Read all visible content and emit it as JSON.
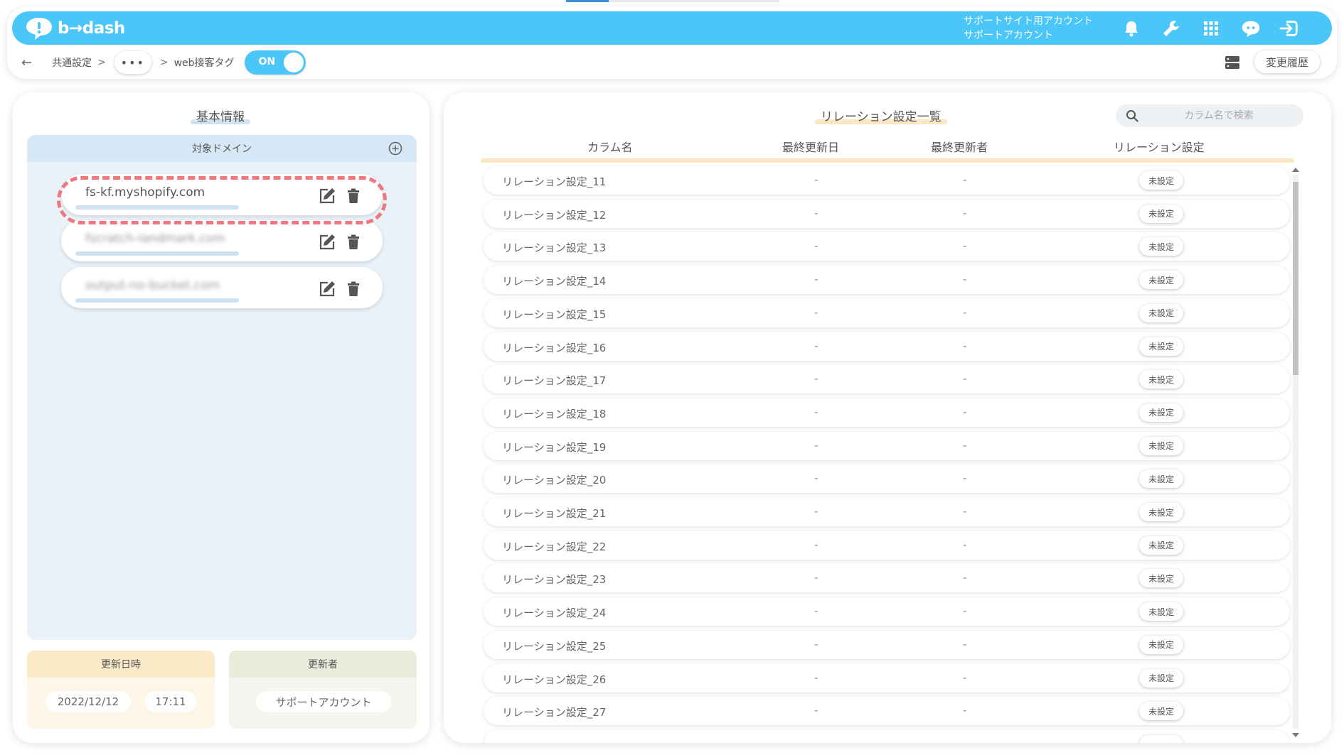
{
  "app": {
    "logo_text": "b→dash",
    "account_line1": "サポートサイト用アカウント",
    "account_line2": "サポートアカウント",
    "brand_color": "#4ac6f8",
    "header_icons": [
      "bell-icon",
      "wrench-icon",
      "grid-icon",
      "chat-bot-icon",
      "logout-icon"
    ]
  },
  "breadcrumb": {
    "back_icon": "back-arrow-icon",
    "item1": "共通設定",
    "sep": ">",
    "ellipsis": "•••",
    "current": "web接客タグ"
  },
  "toggle": {
    "label": "ON",
    "state": "on"
  },
  "toolbar": {
    "history_label": "変更履歴",
    "layout_icon": "storage-icon"
  },
  "left_panel": {
    "title": "基本情報",
    "domain_header": "対象ドメイン",
    "domains": [
      {
        "text": "fs-kf.myshopify.com",
        "blurred": false,
        "highlighted": true
      },
      {
        "text": "fscratch-landmark.com",
        "blurred": true,
        "highlighted": false
      },
      {
        "text": "output-no-bucket.com",
        "blurred": true,
        "highlighted": false
      }
    ],
    "updated_at": {
      "label": "更新日時",
      "date": "2022/12/12",
      "time": "17:11"
    },
    "updated_by": {
      "label": "更新者",
      "value": "サポートアカウント"
    }
  },
  "right_panel": {
    "title": "リレーション設定一覧",
    "search_placeholder": "カラム名で検索",
    "columns": [
      "カラム名",
      "最終更新日",
      "最終更新者",
      "リレーション設定"
    ],
    "rows": [
      {
        "name": "リレーション設定_11",
        "date": "-",
        "user": "-",
        "status": "未設定"
      },
      {
        "name": "リレーション設定_12",
        "date": "-",
        "user": "-",
        "status": "未設定"
      },
      {
        "name": "リレーション設定_13",
        "date": "-",
        "user": "-",
        "status": "未設定"
      },
      {
        "name": "リレーション設定_14",
        "date": "-",
        "user": "-",
        "status": "未設定"
      },
      {
        "name": "リレーション設定_15",
        "date": "-",
        "user": "-",
        "status": "未設定"
      },
      {
        "name": "リレーション設定_16",
        "date": "-",
        "user": "-",
        "status": "未設定"
      },
      {
        "name": "リレーション設定_17",
        "date": "-",
        "user": "-",
        "status": "未設定"
      },
      {
        "name": "リレーション設定_18",
        "date": "-",
        "user": "-",
        "status": "未設定"
      },
      {
        "name": "リレーション設定_19",
        "date": "-",
        "user": "-",
        "status": "未設定"
      },
      {
        "name": "リレーション設定_20",
        "date": "-",
        "user": "-",
        "status": "未設定"
      },
      {
        "name": "リレーション設定_21",
        "date": "-",
        "user": "-",
        "status": "未設定"
      },
      {
        "name": "リレーション設定_22",
        "date": "-",
        "user": "-",
        "status": "未設定"
      },
      {
        "name": "リレーション設定_23",
        "date": "-",
        "user": "-",
        "status": "未設定"
      },
      {
        "name": "リレーション設定_24",
        "date": "-",
        "user": "-",
        "status": "未設定"
      },
      {
        "name": "リレーション設定_25",
        "date": "-",
        "user": "-",
        "status": "未設定"
      },
      {
        "name": "リレーション設定_26",
        "date": "-",
        "user": "-",
        "status": "未設定"
      },
      {
        "name": "リレーション設定_27",
        "date": "-",
        "user": "-",
        "status": "未設定"
      }
    ]
  }
}
